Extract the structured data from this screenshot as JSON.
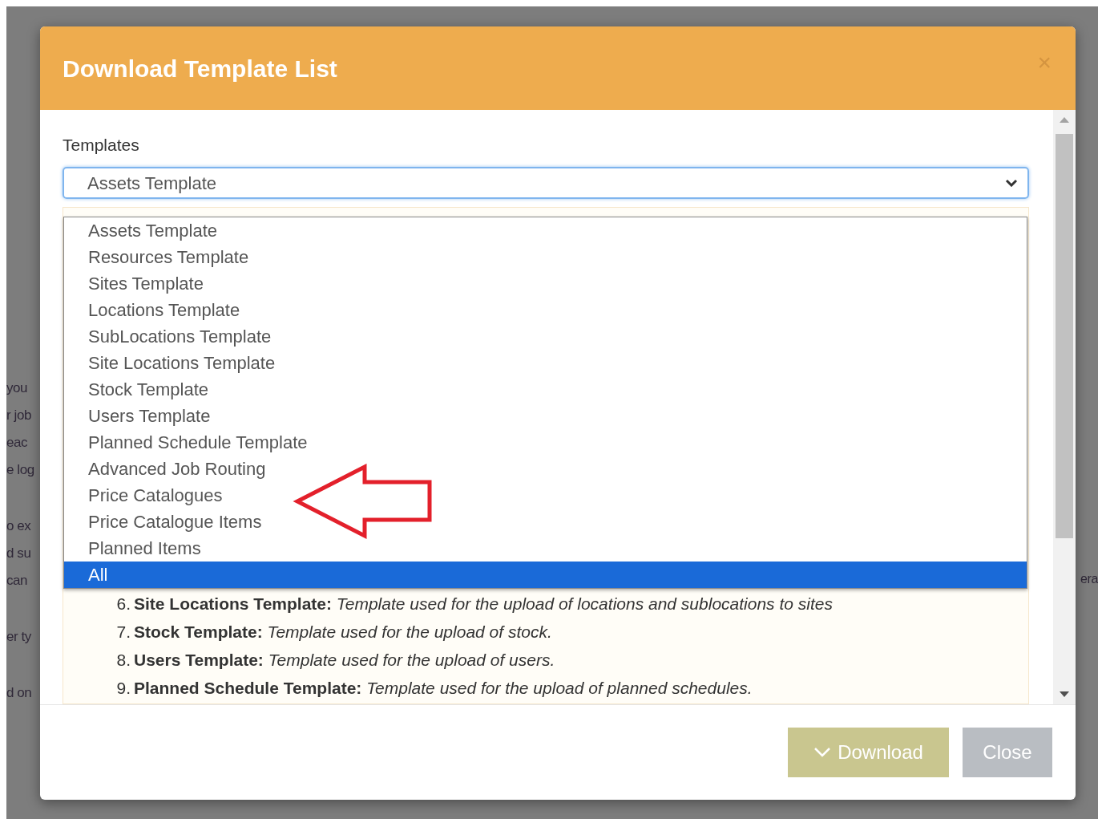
{
  "background": {
    "left_paragraphs": [
      [
        "you",
        "r job",
        "eac",
        "e log"
      ],
      [
        "o ex",
        "d su",
        "can"
      ],
      [
        "er ty"
      ],
      [
        "d on"
      ]
    ],
    "right_lines": [
      "era"
    ]
  },
  "dialog": {
    "title": "Download Template List",
    "close": "×",
    "field_label": "Templates",
    "select": {
      "value": "Assets Template",
      "expanded": true
    },
    "options": [
      {
        "label": "Assets Template",
        "selected": false
      },
      {
        "label": "Resources Template",
        "selected": false
      },
      {
        "label": "Sites Template",
        "selected": false
      },
      {
        "label": "Locations Template",
        "selected": false
      },
      {
        "label": "SubLocations Template",
        "selected": false
      },
      {
        "label": "Site Locations Template",
        "selected": false
      },
      {
        "label": "Stock Template",
        "selected": false
      },
      {
        "label": "Users Template",
        "selected": false
      },
      {
        "label": "Planned Schedule Template",
        "selected": false
      },
      {
        "label": "Advanced Job Routing",
        "selected": false
      },
      {
        "label": "Price Catalogues",
        "selected": false
      },
      {
        "label": "Price Catalogue Items",
        "selected": false
      },
      {
        "label": "Planned Items",
        "selected": false
      },
      {
        "label": "All",
        "selected": true
      }
    ],
    "descriptions": [
      {
        "number": "6.",
        "text": "**Site Locations Template:** *Template used for the upload of locations and sublocations to sites*"
      },
      {
        "number": "7.",
        "text": "**Stock Template:** *Template used for the upload of stock.*"
      },
      {
        "number": "8.",
        "text": "**Users Template:** *Template used for the upload of users.*"
      },
      {
        "number": "9.",
        "text": "**Planned Schedule Template:** *Template used for the upload of planned schedules.*"
      }
    ],
    "buttons": [
      {
        "kind": "primary",
        "label": "Download"
      },
      {
        "kind": "secondary",
        "label": "Close"
      }
    ]
  }
}
